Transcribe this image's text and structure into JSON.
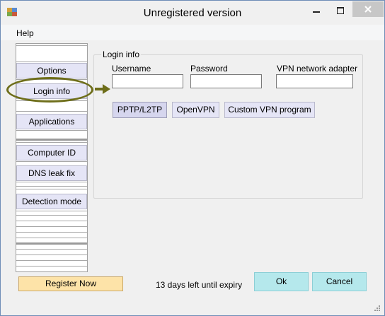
{
  "window": {
    "title": "Unregistered version"
  },
  "menu": {
    "help": "Help"
  },
  "sidebar": {
    "options": "Options",
    "login_info": "Login info",
    "applications": "Applications",
    "computer_id": "Computer ID",
    "dns_leak_fix": "DNS leak fix",
    "detection_mode": "Detection mode"
  },
  "login_group": {
    "title": "Login info",
    "username_label": "Username",
    "password_label": "Password",
    "adapter_label": "VPN network adapter",
    "username_value": "",
    "password_value": "",
    "adapter_value": ""
  },
  "protocols": {
    "pptp": "PPTP/L2TP",
    "openvpn": "OpenVPN",
    "custom": "Custom VPN program"
  },
  "footer": {
    "register": "Register Now",
    "expiry": "13 days left until expiry",
    "ok": "Ok",
    "cancel": "Cancel"
  },
  "colors": {
    "accent_button": "#b5e8ec",
    "register_button": "#fde3a8",
    "nav_button": "#e5e5f6",
    "annotation": "#6e6e1a"
  }
}
